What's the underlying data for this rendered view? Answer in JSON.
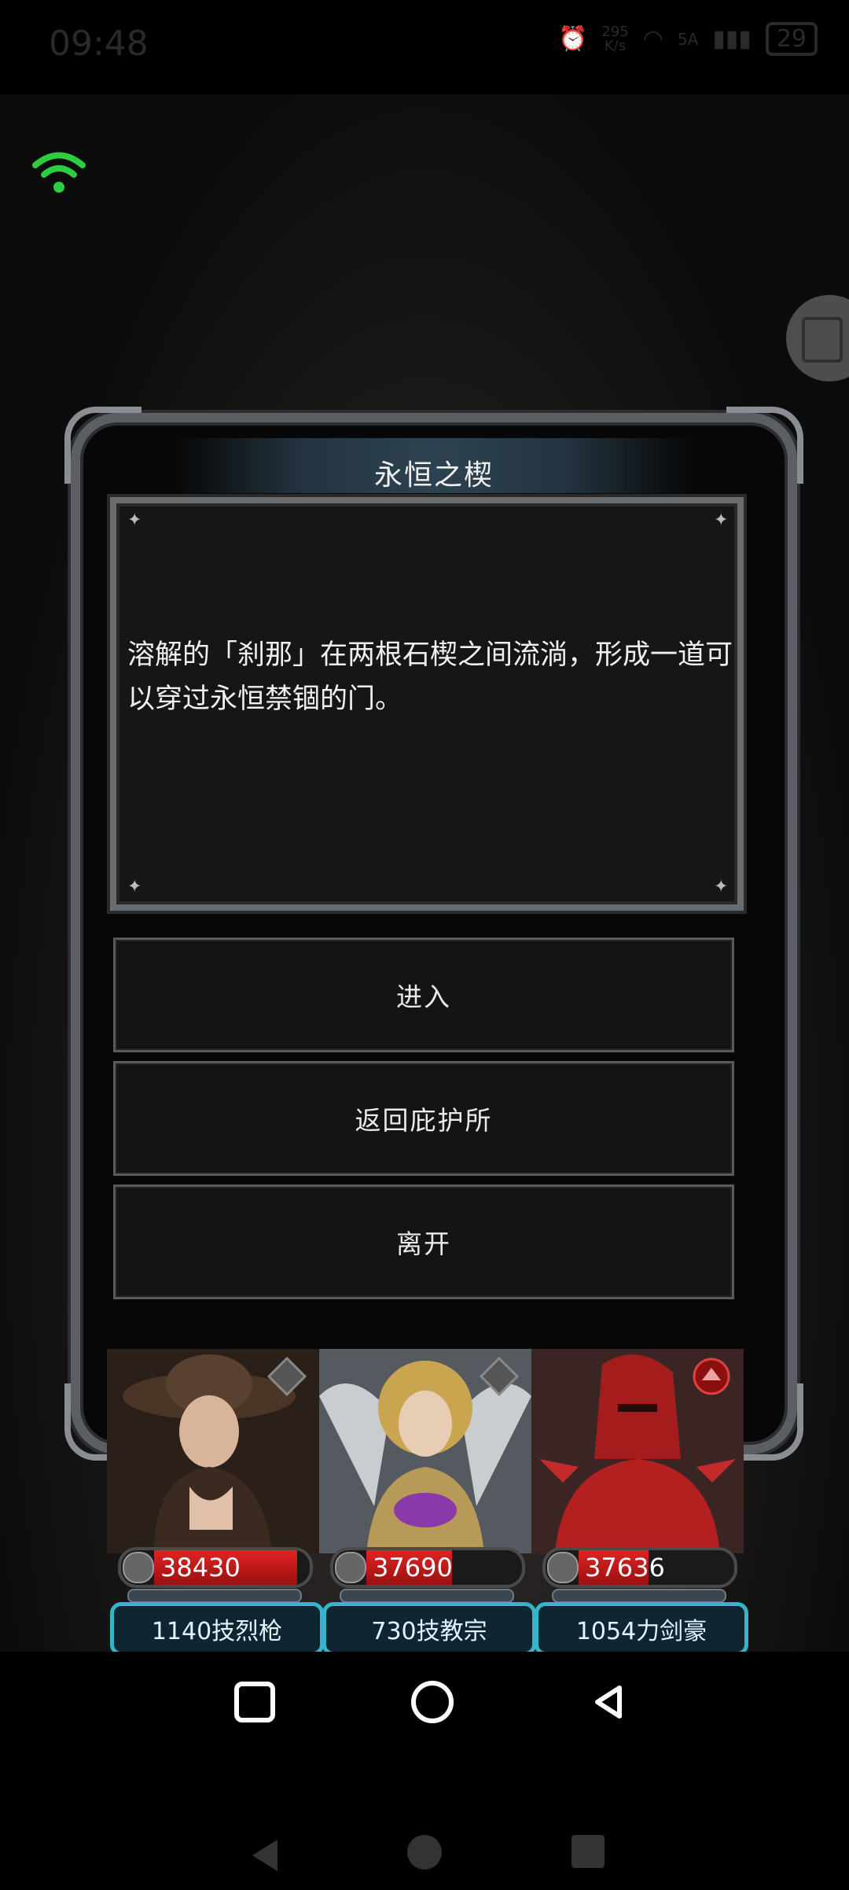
{
  "status_bar": {
    "time": "09:48",
    "speed_value": "295",
    "speed_unit": "K/s",
    "network": "5A",
    "battery": "29"
  },
  "dialog": {
    "title": "永恒之楔",
    "description": "溶解的「刹那」在两根石楔之间流淌，形成一道可以穿过永恒禁锢的门。",
    "options": [
      "进入",
      "返回庇护所",
      "离开"
    ]
  },
  "heroes": [
    {
      "hp": "38430",
      "hp_fraction": 0.92,
      "label": "1140技烈枪",
      "rank_icon": "gray-crest-icon"
    },
    {
      "hp": "37690",
      "hp_fraction": 0.55,
      "label": "730技教宗",
      "rank_icon": "gray-crest-icon"
    },
    {
      "hp": "37636",
      "hp_fraction": 0.45,
      "label": "1054力剑豪",
      "rank_icon": "red-crest-icon"
    }
  ],
  "colors": {
    "accent_plate": "#34b5c9",
    "hp_red": "#e02424",
    "wifi_green": "#2ecc40"
  }
}
